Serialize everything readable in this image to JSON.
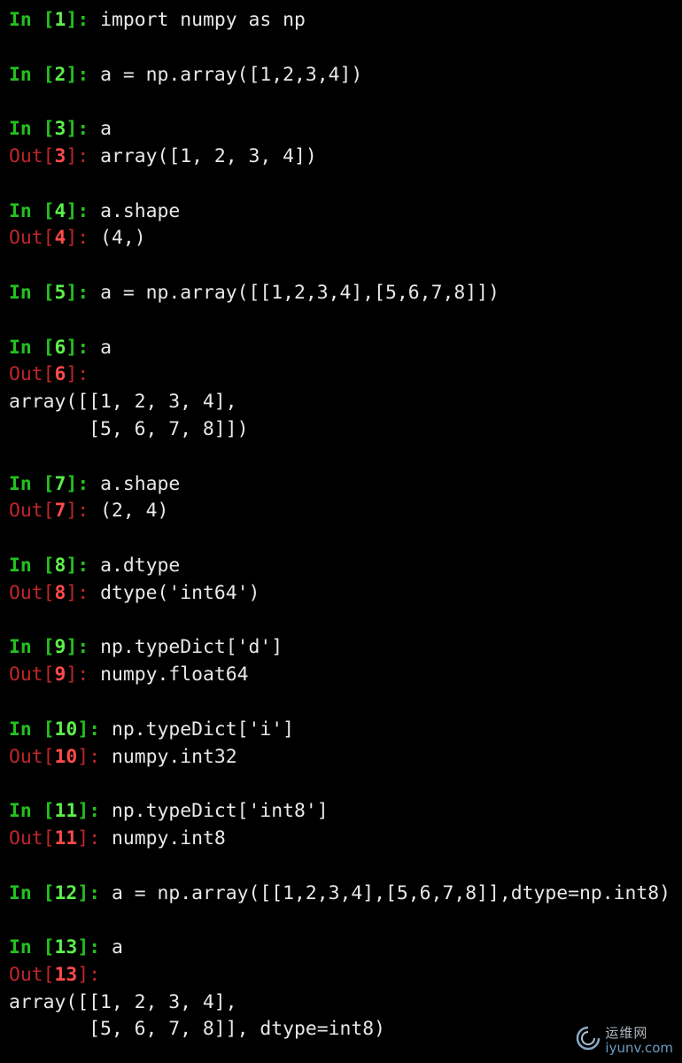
{
  "lines": [
    {
      "type": "in",
      "n": "1",
      "code": "import numpy as np"
    },
    {
      "type": "blank"
    },
    {
      "type": "in",
      "n": "2",
      "code": "a = np.array([1,2,3,4])"
    },
    {
      "type": "blank"
    },
    {
      "type": "in",
      "n": "3",
      "code": "a"
    },
    {
      "type": "out",
      "n": "3",
      "code": "array([1, 2, 3, 4])"
    },
    {
      "type": "blank"
    },
    {
      "type": "in",
      "n": "4",
      "code": "a.shape"
    },
    {
      "type": "out",
      "n": "4",
      "code": "(4,)"
    },
    {
      "type": "blank"
    },
    {
      "type": "in",
      "n": "5",
      "code": "a = np.array([[1,2,3,4],[5,6,7,8]])"
    },
    {
      "type": "blank"
    },
    {
      "type": "in",
      "n": "6",
      "code": "a"
    },
    {
      "type": "out",
      "n": "6",
      "code": ""
    },
    {
      "type": "text",
      "code": "array([[1, 2, 3, 4],"
    },
    {
      "type": "text",
      "code": "       [5, 6, 7, 8]])"
    },
    {
      "type": "blank"
    },
    {
      "type": "in",
      "n": "7",
      "code": "a.shape"
    },
    {
      "type": "out",
      "n": "7",
      "code": "(2, 4)"
    },
    {
      "type": "blank"
    },
    {
      "type": "in",
      "n": "8",
      "code": "a.dtype"
    },
    {
      "type": "out",
      "n": "8",
      "code": "dtype('int64')"
    },
    {
      "type": "blank"
    },
    {
      "type": "in",
      "n": "9",
      "code": "np.typeDict['d']"
    },
    {
      "type": "out",
      "n": "9",
      "code": "numpy.float64"
    },
    {
      "type": "blank"
    },
    {
      "type": "in",
      "n": "10",
      "code": "np.typeDict['i']"
    },
    {
      "type": "out",
      "n": "10",
      "code": "numpy.int32"
    },
    {
      "type": "blank"
    },
    {
      "type": "in",
      "n": "11",
      "code": "np.typeDict['int8']"
    },
    {
      "type": "out",
      "n": "11",
      "code": "numpy.int8"
    },
    {
      "type": "blank"
    },
    {
      "type": "in",
      "n": "12",
      "code": "a = np.array([[1,2,3,4],[5,6,7,8]],dtype=np.int8)"
    },
    {
      "type": "blank"
    },
    {
      "type": "in",
      "n": "13",
      "code": "a"
    },
    {
      "type": "out",
      "n": "13",
      "code": ""
    },
    {
      "type": "text",
      "code": "array([[1, 2, 3, 4],"
    },
    {
      "type": "text",
      "code": "       [5, 6, 7, 8]], dtype=int8)"
    }
  ],
  "prompt": {
    "in_label": "In",
    "out_label": "Out",
    "open_bracket": "[",
    "close_bracket": "]",
    "colon": ": "
  },
  "colors": {
    "background": "#000000",
    "in_prompt": "#23c11f",
    "in_number": "#5cf04a",
    "out_prompt": "#c0262a",
    "out_number": "#ff4a4a",
    "text": "#e8e8e8"
  },
  "watermark": {
    "name": "运维网",
    "url": "iyunv.com",
    "icon": "swirl-logo-icon"
  }
}
